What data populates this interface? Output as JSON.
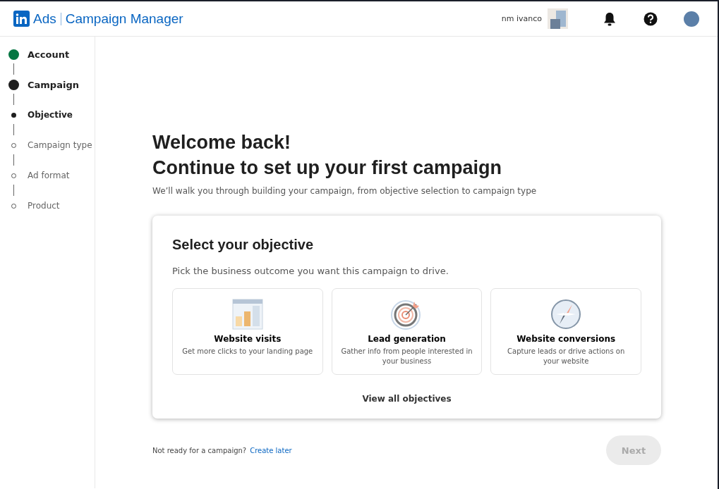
{
  "header": {
    "brand": "Ads",
    "product": "Campaign Manager",
    "account_name": "nm ivanco"
  },
  "steps": [
    {
      "label": "Account",
      "kind": "major",
      "completed": true,
      "current": false
    },
    {
      "label": "Campaign",
      "kind": "major",
      "completed": false,
      "current": true
    },
    {
      "label": "Objective",
      "kind": "minor",
      "completed": false,
      "current": true
    },
    {
      "label": "Campaign type",
      "kind": "minor",
      "completed": false,
      "current": false
    },
    {
      "label": "Ad format",
      "kind": "minor",
      "completed": false,
      "current": false
    },
    {
      "label": "Product",
      "kind": "minor",
      "completed": false,
      "current": false
    }
  ],
  "heading": [
    "Welcome back!",
    "Continue to set up your first campaign"
  ],
  "intro": "We’ll walk you through building your campaign, from objective selection to campaign type",
  "objective_card": {
    "title": "Select your objective",
    "subtitle": "Pick the business outcome you want this campaign to drive.",
    "options": [
      {
        "kind": "chart",
        "title": "Website visits",
        "description": "Get more clicks to your landing page"
      },
      {
        "kind": "target",
        "title": "Lead generation",
        "description": "Gather info from people interested in your business"
      },
      {
        "kind": "compass",
        "title": "Website conversions",
        "description": "Capture leads or drive actions on your website"
      }
    ],
    "link": "View all objectives"
  },
  "footer": {
    "prompt": "Not ready for a campaign?",
    "link": "Create later",
    "next": {
      "label": "Next",
      "disabled": true
    }
  }
}
